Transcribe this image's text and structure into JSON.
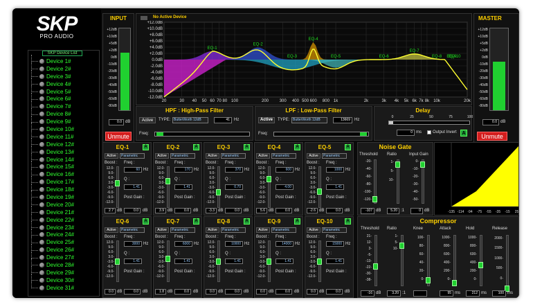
{
  "brand": {
    "name": "SKP",
    "tagline": "PRO AUDIO"
  },
  "device_list": {
    "header": "SKP Device List",
    "items": [
      "Device 1#",
      "Device 2#",
      "Device 3#",
      "Device 4#",
      "Device 5#",
      "Device 6#",
      "Device 7#",
      "Device 8#",
      "Device 9#",
      "Device 10#",
      "Device 11#",
      "Device 12#",
      "Device 13#",
      "Device 14#",
      "Device 15#",
      "Device 16#",
      "Device 17#",
      "Device 18#",
      "Device 19#",
      "Device 20#",
      "Device 21#",
      "Device 22#",
      "Device 23#",
      "Device 24#",
      "Device 25#",
      "Device 26#",
      "Device 27#",
      "Device 28#",
      "Device 29#",
      "Device 30#",
      "Device 31#"
    ]
  },
  "input": {
    "title": "INPUT",
    "value": "0.0",
    "unit": "dB",
    "unmute": "Unmute",
    "scale": [
      "+12dB",
      "+10dB",
      "+5dB",
      "+2dB",
      "0dB",
      "-10dB",
      "-20dB",
      "-30dB",
      "-40dB",
      "-50dB",
      "-60dB",
      "-80dB"
    ]
  },
  "master": {
    "title": "MASTER",
    "value": "0.0",
    "unit": "dB",
    "unmute": "Unmute",
    "scale": [
      "+12dB",
      "+10dB",
      "+5dB",
      "+2dB",
      "0dB",
      "-10dB",
      "-20dB",
      "-30dB",
      "-40dB",
      "-50dB",
      "-60dB",
      "-80dB"
    ]
  },
  "graph": {
    "status": "No Active Device",
    "y_labels": [
      "+12.0dB",
      "+10.0dB",
      "+8.0dB",
      "+6.0dB",
      "+4.0dB",
      "+2.0dB",
      "0.0dB",
      "-2.0dB",
      "-4.0dB",
      "-6.0dB",
      "-8.0dB",
      "-10.0dB",
      "-12.0dB"
    ],
    "x_labels": [
      "20",
      "30",
      "40",
      "50",
      "60",
      "70",
      "80",
      "100",
      "200",
      "300",
      "400",
      "500",
      "600",
      "800",
      "1k",
      "2k",
      "3k",
      "4k",
      "5k",
      "6k",
      "7k",
      "8k",
      "10k",
      "20k"
    ],
    "eq_labels": [
      "EQ-1",
      "EQ-2",
      "EQ-3",
      "EQ-4",
      "EQ-5",
      "EQ-6",
      "EQ-7",
      "EQ-8",
      "EQ-9",
      "EQ-10"
    ]
  },
  "hpf": {
    "title": "HPF : High-Pass Filter",
    "active": "Active",
    "type_label": "TYPE:",
    "type": "ButterWorth 12dB",
    "value": "41",
    "unit": "Hz",
    "freq_label": "Freq:"
  },
  "lpf": {
    "title": "LPF : Low-Pass Filter",
    "active": "Active",
    "type_label": "TYPE:",
    "type": "ButterWorth 12dB",
    "value": "13669",
    "unit": "Hz",
    "freq_label": "Freq:"
  },
  "delay": {
    "title": "Delay",
    "ticks": [
      "0",
      "25",
      "50",
      "75",
      "100"
    ],
    "value": "0",
    "unit": "ms",
    "invert": "Output Invert",
    "a": "A"
  },
  "eq_common": {
    "active": "Active",
    "type": "Parametric",
    "boost": "Boost :",
    "freq": "Freq :",
    "q": "Q :",
    "post": "Post Gain :",
    "hz": "Hz",
    "db": "dB",
    "a": "A",
    "scale": [
      "12.0-",
      "9.0-",
      "6.0-",
      "3.0-",
      "",
      "-3.0-",
      "-6.0-",
      "-9.0-",
      "-12.0-"
    ]
  },
  "eqs": [
    {
      "name": "EQ-1",
      "freq": "60",
      "q": "1.41",
      "gain": "2.7",
      "post": "0.0"
    },
    {
      "name": "EQ-2",
      "freq": "170",
      "q": "1.41",
      "gain": "3.9",
      "post": "0.0"
    },
    {
      "name": "EQ-3",
      "freq": "370",
      "q": "0.70",
      "gain": "-3.3",
      "post": "0.0"
    },
    {
      "name": "EQ-4",
      "freq": "600",
      "q": "4.00",
      "gain": "5.6",
      "post": "0.0"
    },
    {
      "name": "EQ-5",
      "freq": "1000",
      "q": "1.41",
      "gain": "-2.6",
      "post": "0.0"
    },
    {
      "name": "EQ-6",
      "freq": "3000",
      "q": "1.41",
      "gain": "0.0",
      "post": "0.0"
    },
    {
      "name": "EQ-7",
      "freq": "6000",
      "q": "1.41",
      "gain": "1.8",
      "post": "0.0"
    },
    {
      "name": "EQ-8",
      "freq": "10000",
      "q": "1.41",
      "gain": "0.0",
      "post": "0.0"
    },
    {
      "name": "EQ-9",
      "freq": "14000",
      "q": "1.41",
      "gain": "0.0",
      "post": "0.0"
    },
    {
      "name": "EQ-10",
      "freq": "15000",
      "q": "1.41",
      "gain": "0.0",
      "post": "0.0"
    }
  ],
  "noise_gate": {
    "title": "Noise Gate",
    "threshold": "Threshold",
    "ratio": "Ratio",
    "input_gain": "Input Gain",
    "th_scale": [
      "-20-",
      "-40-",
      "-60-",
      "-80-",
      "-100-",
      "-120-"
    ],
    "ratio_scale": [
      "1-",
      "",
      "5-",
      "",
      "10-"
    ],
    "gain_scale": [
      "0-",
      "-10-",
      "-20-",
      "-30-",
      "-40-",
      "-50-"
    ],
    "th_value": "-107",
    "ratio_value": "5.20",
    "ratio_unit": ":1",
    "gain_value": "0",
    "unit": "dB",
    "graph_x": [
      "-135",
      "-114",
      "-94",
      "-75",
      "-55",
      "-35",
      "-15",
      "25"
    ]
  },
  "compressor": {
    "title": "Compressor",
    "threshold": "Threshold",
    "ratio": "Ratio",
    "knee": "Knee",
    "attack": "Attack",
    "hold": "Hold",
    "release": "Release",
    "th_scale": [
      "21-",
      "12-",
      "3-",
      "-5-",
      "-13-",
      "-22-",
      "-30-",
      "-38-"
    ],
    "ratio_scale": [
      "1-",
      "",
      "",
      "5-",
      "",
      "",
      "",
      "10-"
    ],
    "knee_scale": [
      "100-",
      "80-",
      "60-",
      "40-",
      "20-",
      "0-"
    ],
    "attack_scale": [
      "1000-",
      "800-",
      "600-",
      "400-",
      "200-",
      "0-"
    ],
    "hold_scale": [
      "1000-",
      "800-",
      "600-",
      "400-",
      "200-",
      "0-"
    ],
    "release_scale": [
      "2000-",
      "1500-",
      "1000-",
      "500-",
      "0-"
    ],
    "th_value": "-16",
    "ratio_value": "3.20",
    "ratio_unit": ":1",
    "knee_value": "",
    "attack_value": "95",
    "hold_value": "212",
    "release_value": "100",
    "db": "dB",
    "ms": "ms"
  },
  "colors": {
    "accent": "#ffd100",
    "green": "#20d030",
    "red": "#d41e1e",
    "list_text": "#30ff30"
  }
}
